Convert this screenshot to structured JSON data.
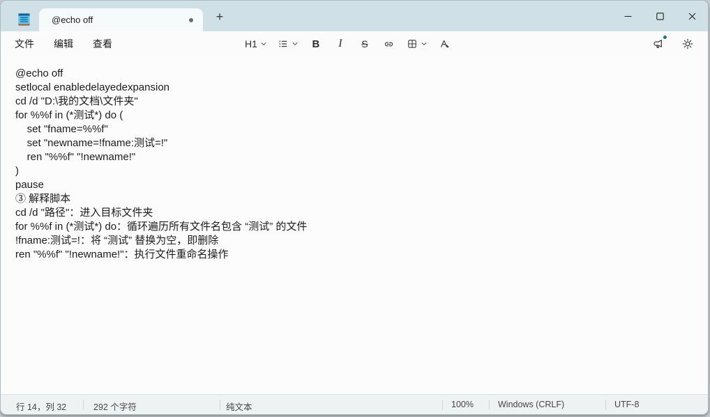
{
  "titlebar": {
    "tab_title": "@echo off",
    "new_tab_label": "+"
  },
  "menubar": {
    "items": [
      {
        "label": "文件"
      },
      {
        "label": "编辑"
      },
      {
        "label": "查看"
      }
    ]
  },
  "toolbar": {
    "heading_label": "H1",
    "bold_label": "B",
    "italic_label": "I",
    "strikethrough_label": "S"
  },
  "editor": {
    "lines": [
      "@echo off",
      "setlocal enabledelayedexpansion",
      "cd /d \"D:\\我的文档\\文件夹\"",
      "for %%f in (*测试*) do (",
      "    set \"fname=%%f\"",
      "    set \"newname=!fname:测试=!\"",
      "    ren \"%%f\" \"!newname!\"",
      ")",
      "pause",
      "③ 解释脚本",
      "cd /d \"路径\"：进入目标文件夹",
      "for %%f in (*测试*) do：循环遍历所有文件名包含 “测试” 的文件",
      "!fname:测试=!：将 “测试” 替换为空，即删除",
      "ren \"%%f\" \"!newname!\"：执行文件重命名操作"
    ]
  },
  "statusbar": {
    "line_col": "行 14，列 32",
    "char_count": "292 个字符",
    "doc_format": "纯文本",
    "zoom_level": "100%",
    "line_ending": "Windows (CRLF)",
    "encoding": "UTF-8"
  },
  "icons": {
    "app": "notepad-icon",
    "modified": "dot-icon",
    "new_tab": "plus-icon",
    "minimize": "minimize-icon",
    "maximize": "maximize-icon",
    "close": "close-icon",
    "heading_dropdown": "chevron-down-icon",
    "list": "bulleted-list-icon",
    "link": "link-icon",
    "table": "table-icon",
    "clear_format": "clear-formatting-icon",
    "announcement": "megaphone-icon",
    "settings": "gear-icon"
  },
  "colors": {
    "titlebar": "#cfe0e7",
    "tab": "#f7fafb",
    "chrome": "#fbfbfb",
    "editor": "#fcfcfc",
    "statusbar": "#eff2f3",
    "notification_dot": "#0f7b8a",
    "text": "#1c1c1c"
  }
}
